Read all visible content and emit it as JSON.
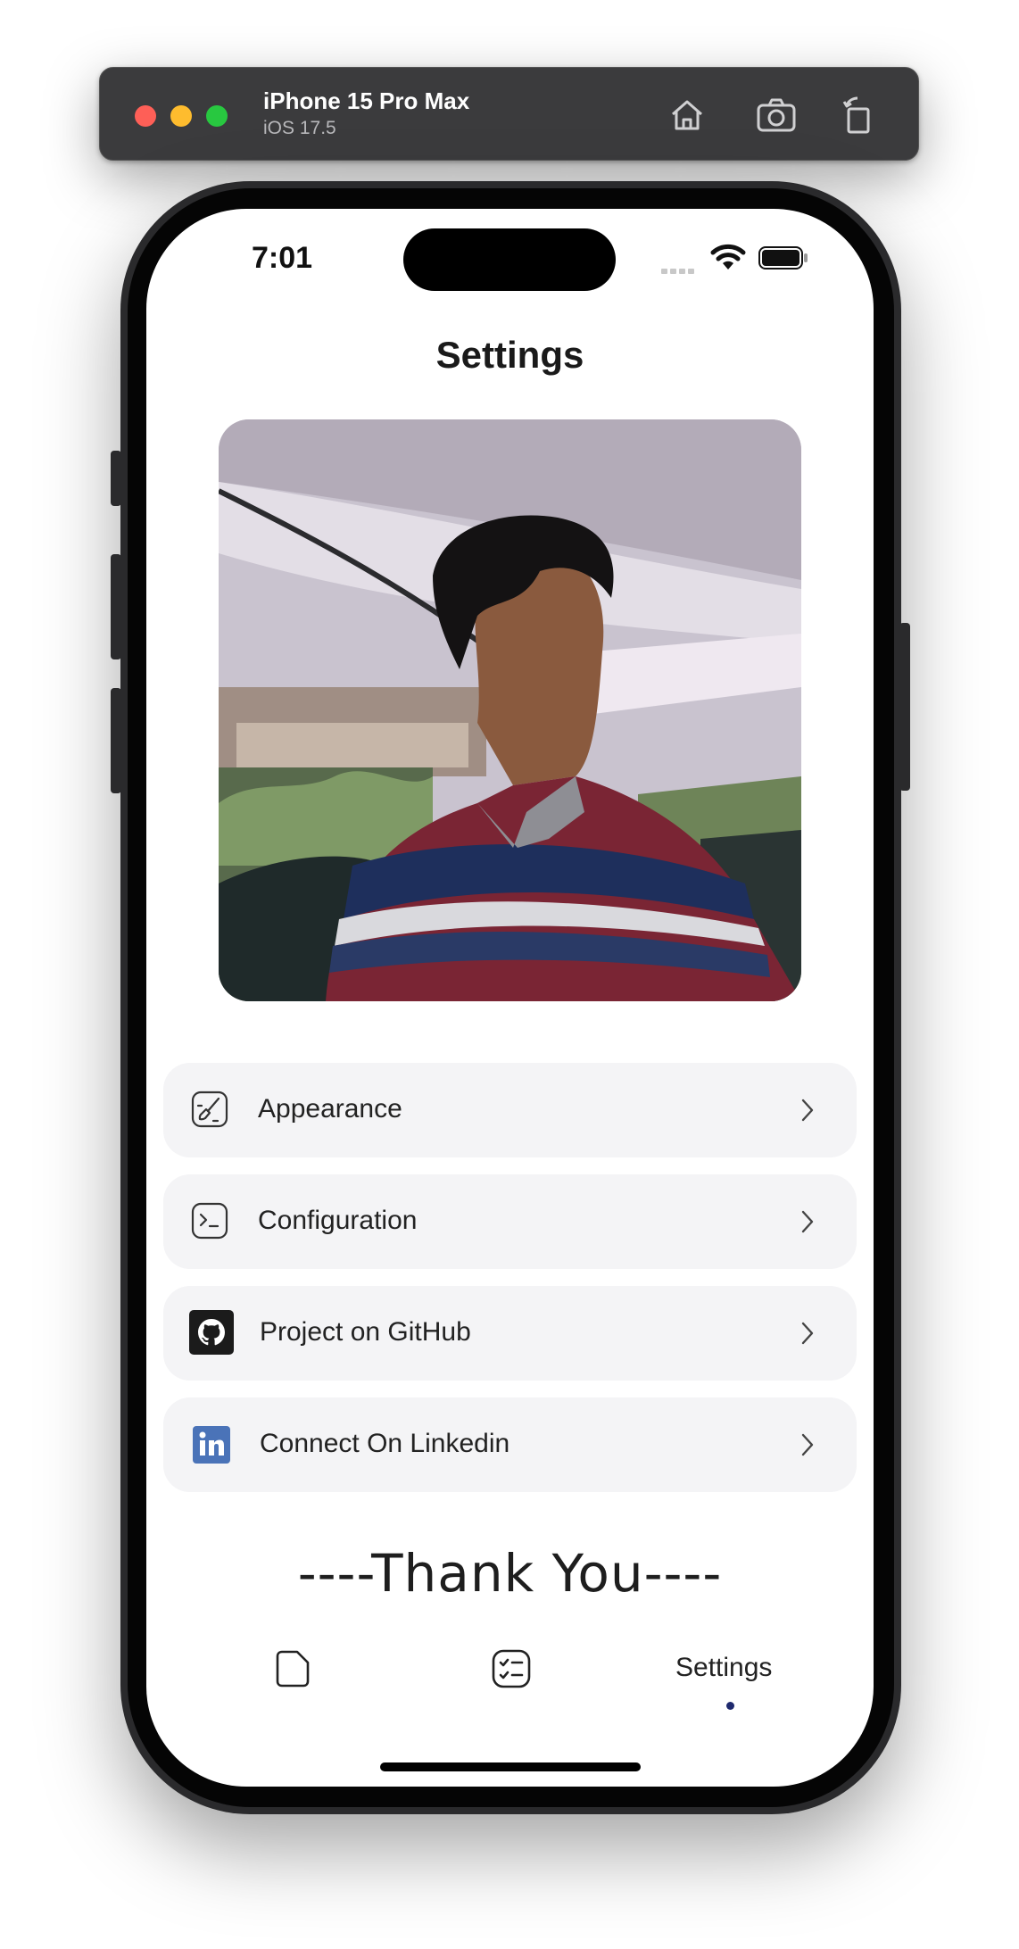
{
  "simulator": {
    "device_name": "iPhone 15 Pro Max",
    "os_version": "iOS 17.5",
    "buttons": [
      "home-icon",
      "screenshot-icon",
      "rotate-icon"
    ]
  },
  "status_bar": {
    "time": "7:01"
  },
  "screen": {
    "title": "Settings",
    "menu": [
      {
        "label": "Appearance",
        "icon": "paintbrush-icon"
      },
      {
        "label": "Configuration",
        "icon": "terminal-icon"
      },
      {
        "label": "Project on GitHub",
        "icon": "github-icon"
      },
      {
        "label": "Connect On Linkedin",
        "icon": "linkedin-icon"
      }
    ],
    "footer_text": "----Thank You----"
  },
  "tab_bar": {
    "tabs": [
      {
        "icon": "notes-icon"
      },
      {
        "icon": "checklist-icon"
      },
      {
        "label": "Settings",
        "selected": true
      }
    ]
  },
  "colors": {
    "accent": "#1f2a6e",
    "linkedin": "#4a73b8",
    "card_bg": "#f4f4f6"
  }
}
